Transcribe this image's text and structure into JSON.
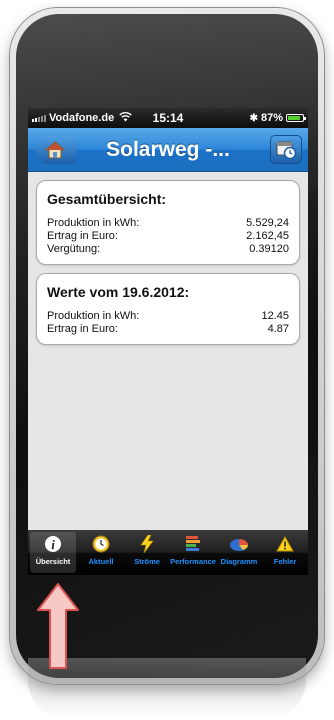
{
  "status_bar": {
    "carrier": "Vodafone.de",
    "time": "15:14",
    "battery": "87%",
    "battery_level": 0.87
  },
  "navbar": {
    "title": "Solarweg -...",
    "back_icon": "house-icon",
    "right_icon": "calendar-clock-icon"
  },
  "overview_card": {
    "title": "Gesamtübersicht:",
    "rows": [
      {
        "label": "Produktion in kWh:",
        "value": "5.529,24"
      },
      {
        "label": "Ertrag in Euro:",
        "value": "2.162,45"
      },
      {
        "label": "Vergütung:",
        "value": "0.39120"
      }
    ]
  },
  "daily_card": {
    "title": "Werte vom 19.6.2012:",
    "rows": [
      {
        "label": "Produktion in kWh:",
        "value": "12.45"
      },
      {
        "label": "Ertrag in Euro:",
        "value": "4.87"
      }
    ]
  },
  "tabbar": {
    "tabs": [
      {
        "label": "Übersicht",
        "icon": "info-icon",
        "active": true
      },
      {
        "label": "Aktuell",
        "icon": "clock-icon",
        "active": false
      },
      {
        "label": "Ströme",
        "icon": "lightning-icon",
        "active": false
      },
      {
        "label": "Performance",
        "icon": "bar-stack-icon",
        "active": false
      },
      {
        "label": "Diagramm",
        "icon": "pie-chart-icon",
        "active": false
      },
      {
        "label": "Fehler",
        "icon": "warning-icon",
        "active": false
      }
    ]
  },
  "colors": {
    "navbar": "#2c86d8",
    "tab_label": "#1e90ff",
    "arrow_fill": "#f6c9c5",
    "arrow_stroke": "#d9534f"
  }
}
